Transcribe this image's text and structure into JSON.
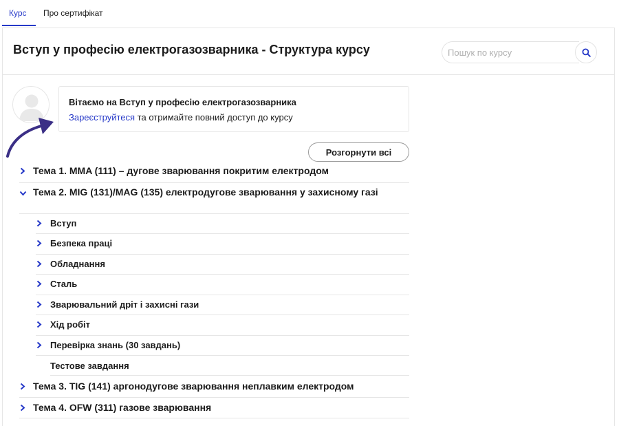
{
  "tabs": [
    {
      "label": "Курс",
      "active": true
    },
    {
      "label": "Про сертифікат",
      "active": false
    }
  ],
  "header": {
    "title": "Вступ у професію електрогазозварника - Структура курсу",
    "search_placeholder": "Пошук по курсу",
    "search_value": ""
  },
  "welcome": {
    "title": "Вітаємо на Вступ у професію електрогазозварника",
    "register_link": "Зареєструйтеся",
    "rest": " та отримайте повний доступ до курсу"
  },
  "expand_all_label": "Розгорнути всі",
  "topics": [
    {
      "label": "Тема 1. MMA (111) – дугове зварювання покритим електродом",
      "expanded": false
    },
    {
      "label": "Тема 2. MIG (131)/MAG (135) електродугове зварювання у захисному газі",
      "expanded": true
    },
    {
      "label": "Тема 3. TIG (141) аргонодугове зварювання неплавким електродом",
      "expanded": false
    },
    {
      "label": "Тема 4. OFW (311) газове зварювання",
      "expanded": false
    }
  ],
  "lessons": [
    {
      "label": "Вступ"
    },
    {
      "label": "Безпека праці"
    },
    {
      "label": "Обладнання"
    },
    {
      "label": "Сталь"
    },
    {
      "label": "Зварювальний дріт і захисні гази"
    },
    {
      "label": "Хід робіт"
    },
    {
      "label": "Перевірка знань (30 завдань)"
    }
  ],
  "test_item_label": "Тестове завдання",
  "colors": {
    "accent": "#2639c8",
    "arrow": "#3b2f86",
    "border": "#e6e6e6",
    "text": "#1c1c1c"
  },
  "icons": {
    "search": "search-icon",
    "chevron_right": "chevron-right-icon",
    "chevron_down": "chevron-down-icon",
    "avatar": "user-avatar-icon",
    "arrow": "curved-arrow-icon"
  }
}
